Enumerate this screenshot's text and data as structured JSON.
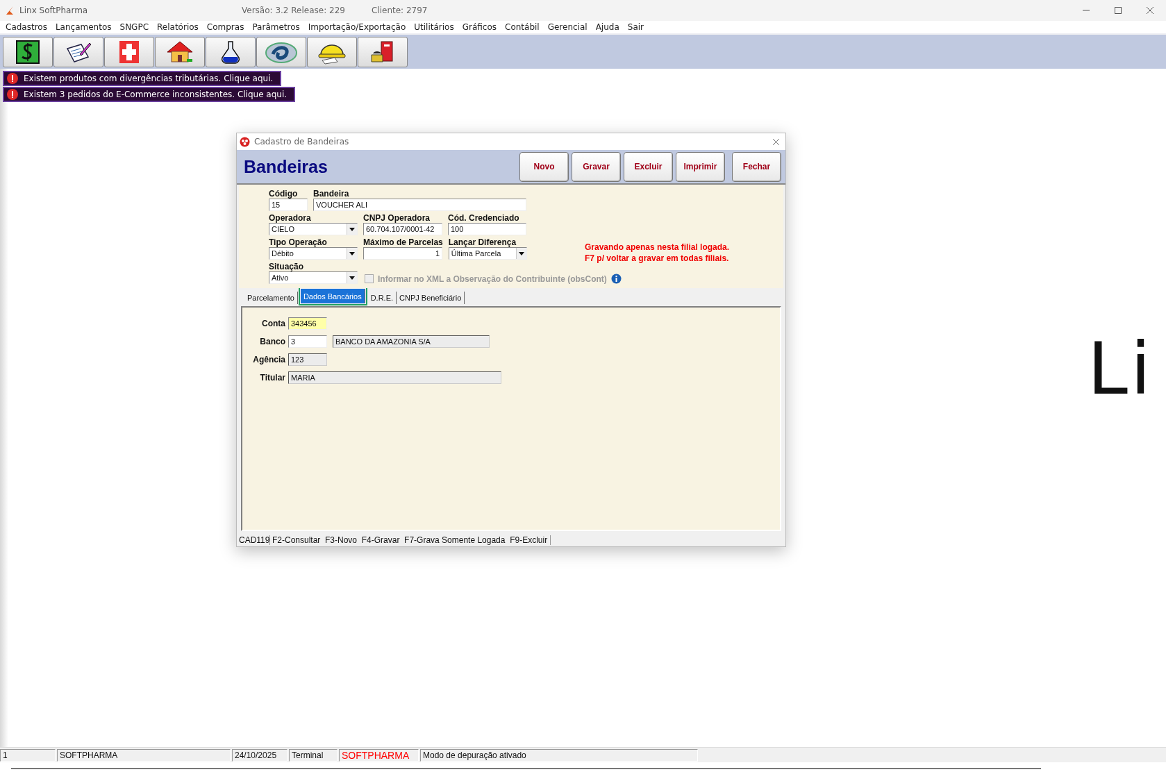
{
  "window": {
    "title": "Linx SoftPharma",
    "version": "Versão: 3.2 Release: 229",
    "client": "Cliente: 2797"
  },
  "menu": [
    "Cadastros",
    "Lançamentos",
    "SNGPC",
    "Relatórios",
    "Compras",
    "Parâmetros",
    "Importação/Exportação",
    "Utilitários",
    "Gráficos",
    "Contábil",
    "Gerencial",
    "Ajuda",
    "Sair"
  ],
  "alerts": [
    "Existem produtos com divergências tributárias. Clique aqui.",
    "Existem 3 pedidos do E-Commerce inconsistentes. Clique aqui."
  ],
  "background_logo": "Li",
  "dialog": {
    "title": "Cadastro de Bandeiras",
    "heading": "Bandeiras",
    "buttons": [
      "Novo",
      "Gravar",
      "Excluir",
      "Imprimir",
      "Fechar"
    ],
    "rows": [
      [
        {
          "label": "Código",
          "value": "15",
          "kind": "text"
        },
        {
          "label": "Bandeira",
          "value": "VOUCHER ALI",
          "kind": "text"
        }
      ],
      [
        {
          "label": "Operadora",
          "value": "CIELO",
          "kind": "combo"
        },
        {
          "label": "CNPJ Operadora",
          "value": "60.704.107/0001-42",
          "kind": "text"
        },
        {
          "label": "Cód. Credenciado",
          "value": "100",
          "kind": "text"
        }
      ],
      [
        {
          "label": "Tipo Operação",
          "value": "Débito",
          "kind": "combo"
        },
        {
          "label": "Máximo de Parcelas",
          "value": "1",
          "kind": "number"
        },
        {
          "label": "Lançar Diferença",
          "value": "Última Parcela",
          "kind": "combo"
        }
      ],
      [
        {
          "label": "Situação",
          "value": "Ativo",
          "kind": "combo"
        }
      ]
    ],
    "notice": [
      "Gravando apenas nesta filial logada.",
      "F7 p/ voltar a gravar em todas filiais."
    ],
    "checkbox": {
      "label": "Informar no XML a Observação do Contribuinte (obsCont)",
      "checked": false,
      "disabled": true
    },
    "tabs": [
      {
        "label": "Parcelamento",
        "selected": false
      },
      {
        "label": "Dados Bancários",
        "selected": true
      },
      {
        "label": "D.R.E.",
        "selected": false
      },
      {
        "label": "CNPJ Beneficiário",
        "selected": false
      }
    ],
    "bank_fields": [
      {
        "label": "Conta",
        "fields": [
          {
            "value": "343456",
            "readonly": false,
            "focused": true
          }
        ]
      },
      {
        "label": "Banco",
        "fields": [
          {
            "value": "3",
            "readonly": false,
            "focused": false
          },
          {
            "value": "BANCO DA AMAZONIA S/A",
            "readonly": true,
            "focused": false
          }
        ]
      },
      {
        "label": "Agência",
        "fields": [
          {
            "value": "123",
            "readonly": true,
            "focused": false
          }
        ]
      },
      {
        "label": "Titular",
        "fields": [
          {
            "value": "MARIA",
            "readonly": true,
            "focused": false
          }
        ]
      }
    ],
    "status": [
      "CAD119",
      "F2-Consultar  F3-Novo  F4-Gravar  F7-Grava Somente Logada  F9-Excluir"
    ]
  },
  "status_bar": [
    {
      "text": "1",
      "kind": "plain"
    },
    {
      "text": "SOFTPHARMA",
      "kind": "plain"
    },
    {
      "text": "24/10/2025",
      "kind": "plain"
    },
    {
      "text": "Terminal",
      "kind": "plain"
    },
    {
      "text": "SOFTPHARMA",
      "kind": "alert"
    },
    {
      "text": "Modo de depuração ativado",
      "kind": "plain"
    }
  ]
}
